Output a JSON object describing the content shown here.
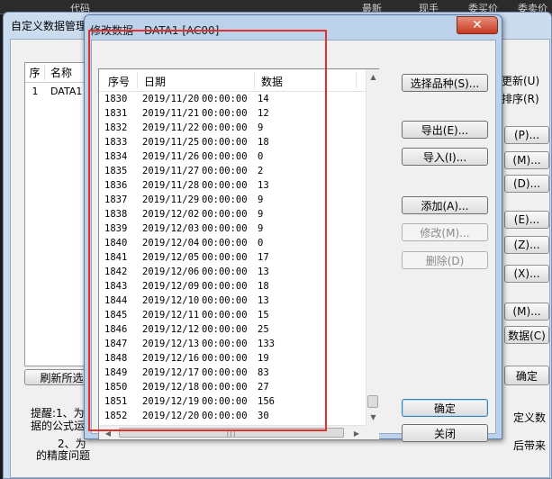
{
  "top_band": {
    "cols": [
      "代码",
      "最新",
      "现手",
      "委买价",
      "委卖价"
    ]
  },
  "bg_window": {
    "title": "自定义数据管理",
    "list_header": {
      "idx": "序",
      "name": "名称"
    },
    "list_rows": [
      {
        "idx": "1",
        "name": "DATA1"
      }
    ],
    "right_labels": [
      "更新(U)",
      "排序(R)"
    ],
    "right_buttons": [
      "(P)...",
      "(M)...",
      "(D)...",
      "(E)...",
      "(Z)...",
      "(X)...",
      "(M)...",
      "数据(C)",
      "确定"
    ],
    "refresh_button": "刷新所选(I)",
    "hint": {
      "line1": "提醒:1、为",
      "line2": "据的公式运",
      "line3": "2、为",
      "line4": "的精度问题",
      "right1": "定义数",
      "right2": "后带来"
    }
  },
  "dialog": {
    "title": "修改数据 - DATA1 [AC00]",
    "close_label": "✕",
    "columns": [
      "序号",
      "日期",
      "数据"
    ],
    "rows": [
      {
        "n": "1830",
        "date": "2019/11/20",
        "time": "00:00:00",
        "v": "14"
      },
      {
        "n": "1831",
        "date": "2019/11/21",
        "time": "00:00:00",
        "v": "12"
      },
      {
        "n": "1832",
        "date": "2019/11/22",
        "time": "00:00:00",
        "v": "9"
      },
      {
        "n": "1833",
        "date": "2019/11/25",
        "time": "00:00:00",
        "v": "18"
      },
      {
        "n": "1834",
        "date": "2019/11/26",
        "time": "00:00:00",
        "v": "0"
      },
      {
        "n": "1835",
        "date": "2019/11/27",
        "time": "00:00:00",
        "v": "2"
      },
      {
        "n": "1836",
        "date": "2019/11/28",
        "time": "00:00:00",
        "v": "13"
      },
      {
        "n": "1837",
        "date": "2019/11/29",
        "time": "00:00:00",
        "v": "9"
      },
      {
        "n": "1838",
        "date": "2019/12/02",
        "time": "00:00:00",
        "v": "9"
      },
      {
        "n": "1839",
        "date": "2019/12/03",
        "time": "00:00:00",
        "v": "9"
      },
      {
        "n": "1840",
        "date": "2019/12/04",
        "time": "00:00:00",
        "v": "0"
      },
      {
        "n": "1841",
        "date": "2019/12/05",
        "time": "00:00:00",
        "v": "17"
      },
      {
        "n": "1842",
        "date": "2019/12/06",
        "time": "00:00:00",
        "v": "13"
      },
      {
        "n": "1843",
        "date": "2019/12/09",
        "time": "00:00:00",
        "v": "18"
      },
      {
        "n": "1844",
        "date": "2019/12/10",
        "time": "00:00:00",
        "v": "13"
      },
      {
        "n": "1845",
        "date": "2019/12/11",
        "time": "00:00:00",
        "v": "15"
      },
      {
        "n": "1846",
        "date": "2019/12/12",
        "time": "00:00:00",
        "v": "25"
      },
      {
        "n": "1847",
        "date": "2019/12/13",
        "time": "00:00:00",
        "v": "133"
      },
      {
        "n": "1848",
        "date": "2019/12/16",
        "time": "00:00:00",
        "v": "19"
      },
      {
        "n": "1849",
        "date": "2019/12/17",
        "time": "00:00:00",
        "v": "83"
      },
      {
        "n": "1850",
        "date": "2019/12/18",
        "time": "00:00:00",
        "v": "27"
      },
      {
        "n": "1851",
        "date": "2019/12/19",
        "time": "00:00:00",
        "v": "156"
      },
      {
        "n": "1852",
        "date": "2019/12/20",
        "time": "00:00:00",
        "v": "30"
      }
    ],
    "buttons": {
      "select_variety": "选择品种(S)...",
      "export": "导出(E)...",
      "import": "导入(I)...",
      "add": "添加(A)...",
      "modify": "修改(M)...",
      "delete": "删除(D)",
      "ok": "确定",
      "close": "关闭"
    }
  },
  "colors": {
    "title_bar": "#bcd2ea",
    "close_red": "#c6391f",
    "highlight_box": "#e0312f"
  }
}
